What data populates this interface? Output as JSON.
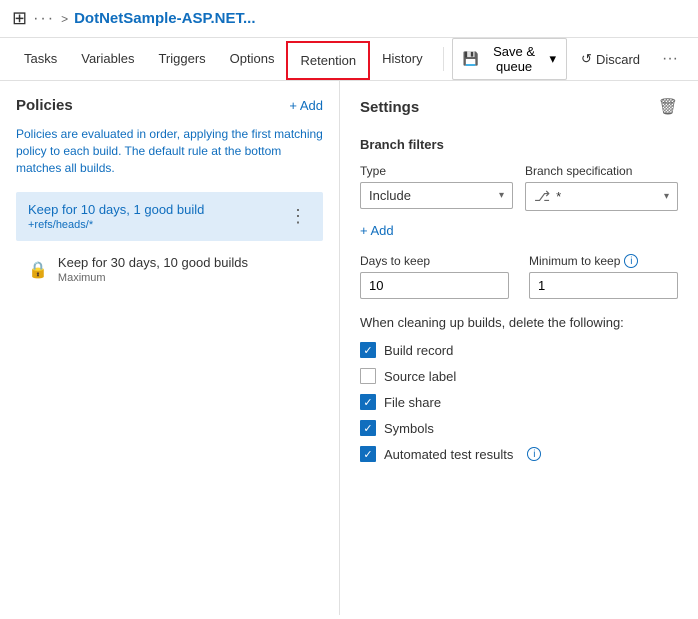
{
  "header": {
    "icon": "⊞",
    "dots": "···",
    "chevron": ">",
    "title": "DotNetSample-ASP.NET..."
  },
  "navbar": {
    "tabs": [
      {
        "id": "tasks",
        "label": "Tasks",
        "active": false,
        "highlighted": false
      },
      {
        "id": "variables",
        "label": "Variables",
        "active": false,
        "highlighted": false
      },
      {
        "id": "triggers",
        "label": "Triggers",
        "active": false,
        "highlighted": false
      },
      {
        "id": "options",
        "label": "Options",
        "active": false,
        "highlighted": false
      },
      {
        "id": "retention",
        "label": "Retention",
        "active": true,
        "highlighted": true
      },
      {
        "id": "history",
        "label": "History",
        "active": false,
        "highlighted": false
      }
    ],
    "save_label": "Save & queue",
    "discard_label": "Discard",
    "more": "···"
  },
  "left": {
    "title": "Policies",
    "add_label": "+ Add",
    "description": "Policies are evaluated in order, applying the first matching policy to each build. The default rule at the bottom matches all builds.",
    "policies": [
      {
        "id": "p1",
        "title": "Keep for 10 days, 1 good build",
        "subtitle": "+refs/heads/*",
        "selected": true,
        "locked": false
      },
      {
        "id": "p2",
        "title": "Keep for 30 days, 10 good builds",
        "subtitle": "Maximum",
        "selected": false,
        "locked": true
      }
    ]
  },
  "right": {
    "title": "Settings",
    "delete_icon": "🗑",
    "branch_filters": {
      "section_title": "Branch filters",
      "type_label": "Type",
      "type_value": "Include",
      "branch_spec_label": "Branch specification",
      "branch_spec_value": "*",
      "add_label": "+ Add"
    },
    "days_to_keep": {
      "label": "Days to keep",
      "value": "10"
    },
    "minimum_to_keep": {
      "label": "Minimum to keep",
      "value": "1"
    },
    "cleanup_label": "When cleaning up builds, delete the following:",
    "checkboxes": [
      {
        "id": "build_record",
        "label": "Build record",
        "checked": true
      },
      {
        "id": "source_label",
        "label": "Source label",
        "checked": false
      },
      {
        "id": "file_share",
        "label": "File share",
        "checked": true
      },
      {
        "id": "symbols",
        "label": "Symbols",
        "checked": true
      },
      {
        "id": "automated_test",
        "label": "Automated test results",
        "checked": true,
        "has_info": true
      }
    ]
  }
}
